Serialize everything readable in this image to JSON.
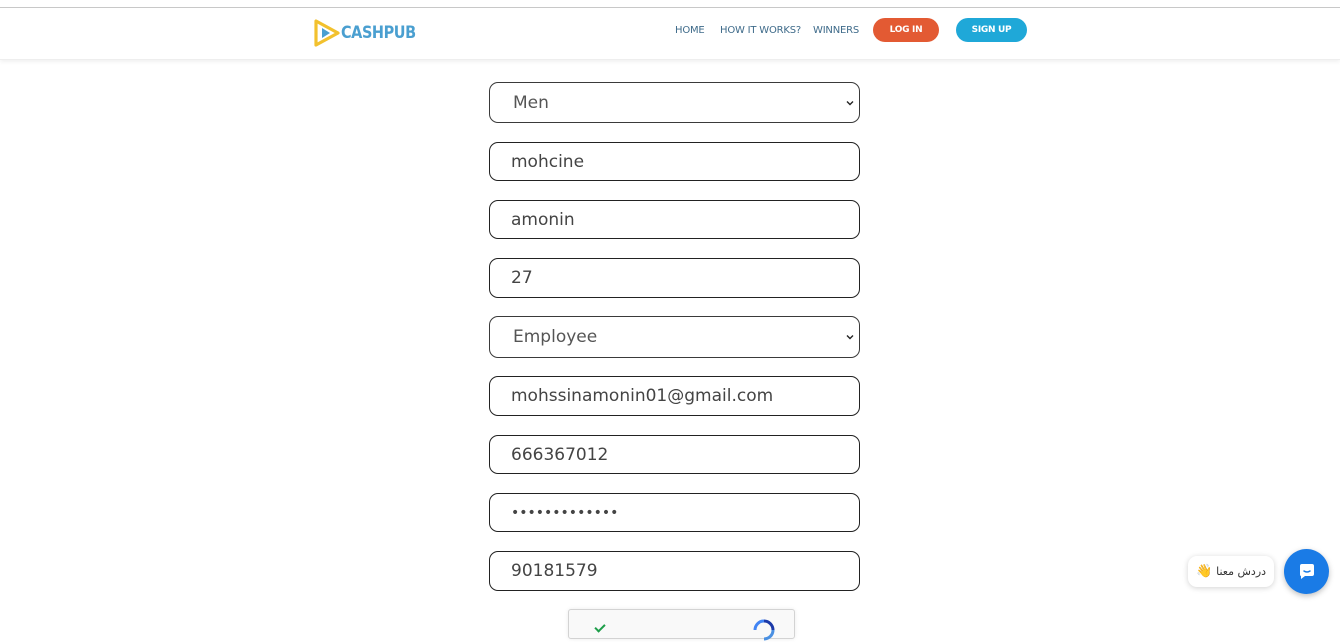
{
  "header": {
    "brand": "CASHPUB",
    "nav": [
      "HOME",
      "HOW IT WORKS?",
      "WINNERS"
    ],
    "login_label": "LOG IN",
    "signup_label": "SIGN UP"
  },
  "form": {
    "gender": "Men",
    "first_name": "mohcine",
    "last_name": "amonin",
    "age": "27",
    "occupation": "Employee",
    "email": "mohssinamonin01@gmail.com",
    "phone": "666367012",
    "password_masked": "•••••••••••••",
    "code": "90181579"
  },
  "chat": {
    "bubble_text": "دردش معنا",
    "wave": "👋"
  },
  "colors": {
    "login": "#e35a33",
    "signup": "#1fa8d8",
    "brand_blue": "#4a9fd0",
    "brand_yellow": "#f2c12e",
    "chat": "#1a7be6"
  },
  "icons": [
    "logo-play-icon",
    "chevron-down-icon",
    "checkmark-icon",
    "recaptcha-icon",
    "chat-icon"
  ]
}
